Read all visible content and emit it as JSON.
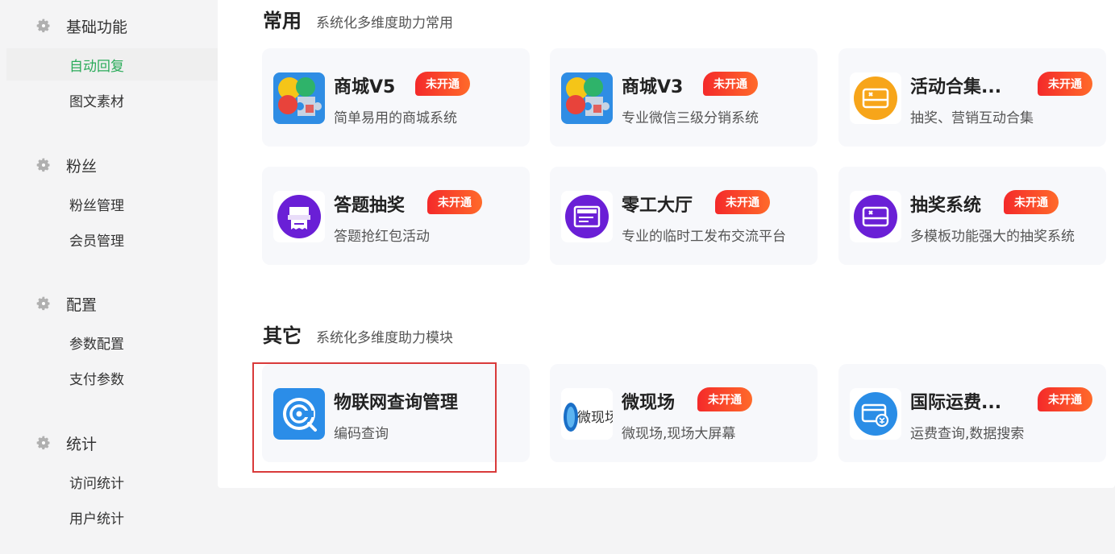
{
  "sidebar": {
    "groups": [
      {
        "title": "基础功能",
        "items": [
          "自动回复",
          "图文素材"
        ]
      },
      {
        "title": "粉丝",
        "items": [
          "粉丝管理",
          "会员管理"
        ]
      },
      {
        "title": "配置",
        "items": [
          "参数配置",
          "支付参数"
        ]
      },
      {
        "title": "统计",
        "items": [
          "访问统计",
          "用户统计"
        ]
      }
    ],
    "active_item": "自动回复"
  },
  "sections": [
    {
      "title": "常用",
      "subtitle": "系统化多维度助力常用",
      "cards": [
        {
          "name": "商城V5",
          "desc": "简单易用的商城系统",
          "badge": "未开通",
          "icon": "puzzle-icon"
        },
        {
          "name": "商城V3",
          "desc": "专业微信三级分销系统",
          "badge": "未开通",
          "icon": "puzzle-icon"
        },
        {
          "name": "活动合集...",
          "desc": "抽奖、营销互动合集",
          "badge": "未开通",
          "icon": "gift-card-icon"
        },
        {
          "name": "答题抽奖",
          "desc": "答题抢红包活动",
          "badge": "未开通",
          "icon": "printer-icon"
        },
        {
          "name": "零工大厅",
          "desc": "专业的临时工发布交流平台",
          "badge": "未开通",
          "icon": "board-icon"
        },
        {
          "name": "抽奖系统",
          "desc": "多模板功能强大的抽奖系统",
          "badge": "未开通",
          "icon": "gift-card-icon"
        }
      ]
    },
    {
      "title": "其它",
      "subtitle": "系统化多维度助力模块",
      "cards": [
        {
          "name": "物联网查询管理",
          "desc": "编码查询",
          "badge": "",
          "icon": "iot-query-icon"
        },
        {
          "name": "微现场",
          "desc": "微现场,现场大屏幕",
          "badge": "未开通",
          "icon": "weixianchang-logo-icon",
          "icon_text": "微现场"
        },
        {
          "name": "国际运费...",
          "desc": "运费查询,数据搜索",
          "badge": "未开通",
          "icon": "freight-card-icon"
        }
      ]
    }
  ],
  "colors": {
    "accent": "#2bab5a",
    "badge_start": "#f42a2a",
    "badge_end": "#ff6a2a",
    "highlight": "#d93a3a"
  }
}
